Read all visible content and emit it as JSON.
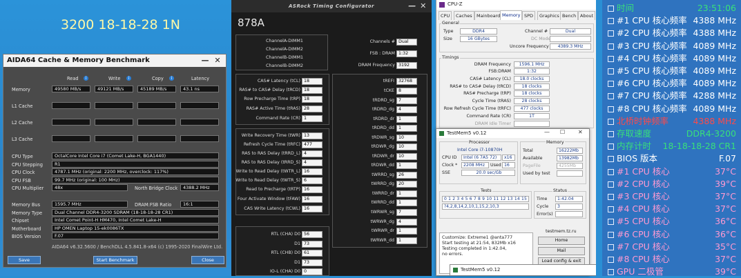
{
  "desktop": {
    "headline": "3200 18-18-28 1N"
  },
  "aida": {
    "title": "AIDA64 Cache & Memory Benchmark",
    "cols": [
      "Read",
      "Write",
      "Copy",
      "Latency"
    ],
    "rows": [
      {
        "label": "Memory",
        "read": "49580 MB/s",
        "write": "49121 MB/s",
        "copy": "45189 MB/s",
        "latency": "43.1 ns"
      },
      {
        "label": "L1 Cache",
        "read": "",
        "write": "",
        "copy": "",
        "latency": ""
      },
      {
        "label": "L2 Cache",
        "read": "",
        "write": "",
        "copy": "",
        "latency": ""
      },
      {
        "label": "L3 Cache",
        "read": "",
        "write": "",
        "copy": "",
        "latency": ""
      }
    ],
    "cpu": [
      {
        "label": "CPU Type",
        "value": "OctalCore Intel Core i7  (Comet Lake-H, BGA1440)"
      },
      {
        "label": "CPU Stepping",
        "value": "R1"
      },
      {
        "label": "CPU Clock",
        "value": "4787.1 MHz  (original: 2200 MHz, overclock: 117%)"
      },
      {
        "label": "CPU FSB",
        "value": "99.7 MHz  (original: 100 MHz)"
      },
      {
        "label": "CPU Multiplier",
        "value": "48x"
      }
    ],
    "nb_label": "North Bridge Clock",
    "nb_value": "4388.2 MHz",
    "mem": [
      {
        "label": "Memory Bus",
        "value": "1595.7 MHz"
      },
      {
        "label": "Memory Type",
        "value": "Dual Channel DDR4-3200 SDRAM  (18-18-18-28 CR1)"
      },
      {
        "label": "Chipset",
        "value": "Intel Comet Point-H HM470, Intel Comet Lake-H"
      },
      {
        "label": "Motherboard",
        "value": "HP OMEN Laptop 15-ek0086TX"
      },
      {
        "label": "BIOS Version",
        "value": "F.07"
      }
    ],
    "ratio_label": "DRAM:FSB Ratio",
    "ratio_value": "16:1",
    "footer": "AIDA64 v6.32.5600 / BenchDLL 4.5.841.8-x64  (c) 1995-2020 FinalWire Ltd.",
    "buttons": {
      "save": "Save",
      "start": "Start Benchmark",
      "close": "Close"
    }
  },
  "asrock": {
    "title": "ASRock Timing Configurator",
    "model": "878A",
    "dimms": [
      "ChannelA-DIMM1",
      "ChannelA-DIMM2",
      "ChannelB-DIMM1",
      "ChannelB-DIMM2"
    ],
    "top_right": [
      {
        "label": "Channels #",
        "value": "Dual"
      },
      {
        "label": "FSB : DRAM",
        "value": "1:32"
      },
      {
        "label": "DRAM Frequency",
        "value": "3192"
      }
    ],
    "primary": [
      {
        "label": "CAS# Latency (tCL)",
        "value": "18"
      },
      {
        "label": "RAS# to CAS# Delay (tRCD)",
        "value": "18"
      },
      {
        "label": "Row Precharge Time (tRP)",
        "value": "18"
      },
      {
        "label": "RAS# Active Time (tRAS)",
        "value": "28"
      },
      {
        "label": "Command Rate (CR)",
        "value": "1"
      }
    ],
    "secondary": [
      {
        "label": "Write Recovery Time (tWR)",
        "value": "13"
      },
      {
        "label": "Refresh Cycle Time (tRFC)",
        "value": "477"
      },
      {
        "label": "RAS to RAS Delay (tRRD_L)",
        "value": "4"
      },
      {
        "label": "RAS to RAS Delay (tRRD_S)",
        "value": "4"
      },
      {
        "label": "Write to Read Delay (tWTR_L)",
        "value": "16"
      },
      {
        "label": "Write to Read Delay (tWTR_S)",
        "value": "6"
      },
      {
        "label": "Read to Precharge (tRTP)",
        "value": "16"
      },
      {
        "label": "Four Activate Window (tFAW)",
        "value": "16"
      },
      {
        "label": "CAS Write Latency (tCWL)",
        "value": "16"
      }
    ],
    "rtl": [
      {
        "label": "RTL (CHA) D0",
        "value": "56"
      },
      {
        "label": "D1",
        "value": "73"
      },
      {
        "label": "RTL (CHB) D0",
        "value": "61"
      },
      {
        "label": "D1",
        "value": "73"
      },
      {
        "label": "IO-L (CHA) D0",
        "value": "0"
      }
    ],
    "right": [
      {
        "label": "tREFI",
        "value": "32768"
      },
      {
        "label": "tCKE",
        "value": "8"
      },
      {
        "label": "tRDRD_sg",
        "value": "7"
      },
      {
        "label": "tRDRD_dg",
        "value": "4"
      },
      {
        "label": "tRDRD_dr",
        "value": "1"
      },
      {
        "label": "tRDRD_dd",
        "value": "1"
      },
      {
        "label": "tRDWR_sg",
        "value": "10"
      },
      {
        "label": "tRDWR_dg",
        "value": "10"
      },
      {
        "label": "tRDWR_dr",
        "value": "10"
      },
      {
        "label": "tRDWR_dd",
        "value": "1"
      },
      {
        "label": "tWRRD_sg",
        "value": "26"
      },
      {
        "label": "tWRRD_dg",
        "value": "20"
      },
      {
        "label": "tWRRD_dr",
        "value": "1"
      },
      {
        "label": "tWRRD_dd",
        "value": "1"
      },
      {
        "label": "tWRWR_sg",
        "value": "7"
      },
      {
        "label": "tWRWR_dg",
        "value": "4"
      },
      {
        "label": "tWRWR_dr",
        "value": "1"
      },
      {
        "label": "tWRWR_dd",
        "value": "1"
      }
    ]
  },
  "cpuz": {
    "title": "CPU-Z",
    "tabs": [
      "CPU",
      "Caches",
      "Mainboard",
      "Memory",
      "SPD",
      "Graphics",
      "Bench",
      "About"
    ],
    "active_tab": "Memory",
    "general_title": "General",
    "type_label": "Type",
    "type_value": "DDR4",
    "size_label": "Size",
    "size_value": "16 GBytes",
    "channel_label": "Channel #",
    "channel_value": "Dual",
    "dcmode_label": "DC Mode",
    "uncore_label": "Uncore Frequency",
    "uncore_value": "4389.3 MHz",
    "timings_title": "Timings",
    "timings": [
      {
        "label": "DRAM Frequency",
        "value": "1596.1 MHz"
      },
      {
        "label": "FSB:DRAM",
        "value": "1:32"
      },
      {
        "label": "CAS# Latency (CL)",
        "value": "18.0 clocks"
      },
      {
        "label": "RAS# to CAS# Delay (tRCD)",
        "value": "18 clocks"
      },
      {
        "label": "RAS# Precharge (tRP)",
        "value": "18 clocks"
      },
      {
        "label": "Cycle Time (tRAS)",
        "value": "28 clocks"
      },
      {
        "label": "Row Refresh Cycle Time (tRFC)",
        "value": "477 clocks"
      },
      {
        "label": "Command Rate (CR)",
        "value": "1T"
      },
      {
        "label": "DRAM Idle Timer",
        "value": ""
      }
    ]
  },
  "testmem": {
    "title": "TestMem5 v0.12",
    "title2": "TestMem5 v0.12",
    "processor_title": "Processor",
    "processor_name": "Intel Core i7-10870H",
    "cpu_id_label": "CPU ID",
    "cpu_id_value": "Intel (6 7A5 72)",
    "cpu_id_threads": "x16",
    "clock_label": "Clock *",
    "clock_value": "2208 MHz",
    "used_label": "Used",
    "used_value": "16",
    "sse_label": "SSE",
    "sse_value": "20.0 sec/Gb",
    "memory_title": "Memory",
    "total_label": "Total",
    "total_value": "16222Mb",
    "avail_label": "Available",
    "avail_value": "13982Mb",
    "pagefile_label": "PageFile",
    "pagefile_value": "4255Mb",
    "usedby_label": "Used by test",
    "tests_title": "Tests",
    "tests_seq": "0 1 2 3 4 5 6 7 8 9 10 11 12 13 14 15",
    "tests_order": "?4,2,8,14,2,10,1,15,2,10,3",
    "status_title": "Status",
    "time_label": "Time",
    "time_value": "1:42.04",
    "cycle_label": "Cycle",
    "cycle_value": "3",
    "errors_label": "Error(s)",
    "log": [
      "Customize: Extreme1 @anta777",
      "Start testing at 21:54, 832Mb x16",
      "Testing completed in 1:42.04,",
      "no errors."
    ],
    "site": "testmem.tz.ru",
    "buttons": {
      "home": "Home",
      "mail": "Mail",
      "load": "Load config & exit"
    }
  },
  "osd": {
    "rows": [
      {
        "key": "时间",
        "value": "23:51:06",
        "color": "#39e07a"
      },
      {
        "key": "#1 CPU 核心频率",
        "value": "4388 MHz",
        "color": "#ffffff"
      },
      {
        "key": "#2 CPU 核心频率",
        "value": "4388 MHz",
        "color": "#ffffff"
      },
      {
        "key": "#3 CPU 核心频率",
        "value": "4089 MHz",
        "color": "#ffffff"
      },
      {
        "key": "#4 CPU 核心频率",
        "value": "4089 MHz",
        "color": "#ffffff"
      },
      {
        "key": "#5 CPU 核心频率",
        "value": "4089 MHz",
        "color": "#ffffff"
      },
      {
        "key": "#6 CPU 核心频率",
        "value": "4089 MHz",
        "color": "#ffffff"
      },
      {
        "key": "#7 CPU 核心频率",
        "value": "4288 MHz",
        "color": "#ffffff"
      },
      {
        "key": "#8 CPU 核心频率",
        "value": "4089 MHz",
        "color": "#ffffff"
      },
      {
        "key": "北桥时钟频率",
        "value": "4388 MHz",
        "color": "#ff4a4a"
      },
      {
        "key": "存取速度",
        "value": "DDR4-3200",
        "color": "#39e07a"
      },
      {
        "key": "内存计时",
        "value": "18-18-18-28 CR1",
        "color": "#39e07a"
      },
      {
        "key": "BIOS 版本",
        "value": "F.07",
        "color": "#ffffff"
      },
      {
        "key": "#1 CPU 核心",
        "value": "37°C",
        "color": "#ff9ad2"
      },
      {
        "key": "#2 CPU 核心",
        "value": "39°C",
        "color": "#ff9ad2"
      },
      {
        "key": "#3 CPU 核心",
        "value": "37°C",
        "color": "#ff9ad2"
      },
      {
        "key": "#4 CPU 核心",
        "value": "37°C",
        "color": "#ff9ad2"
      },
      {
        "key": "#5 CPU 核心",
        "value": "36°C",
        "color": "#ff9ad2"
      },
      {
        "key": "#6 CPU 核心",
        "value": "36°C",
        "color": "#ff9ad2"
      },
      {
        "key": "#7 CPU 核心",
        "value": "35°C",
        "color": "#ff9ad2"
      },
      {
        "key": "#8 CPU 核心",
        "value": "37°C",
        "color": "#ff9ad2"
      },
      {
        "key": "GPU 二极管",
        "value": "39°C",
        "color": "#ff9ad2"
      }
    ]
  }
}
